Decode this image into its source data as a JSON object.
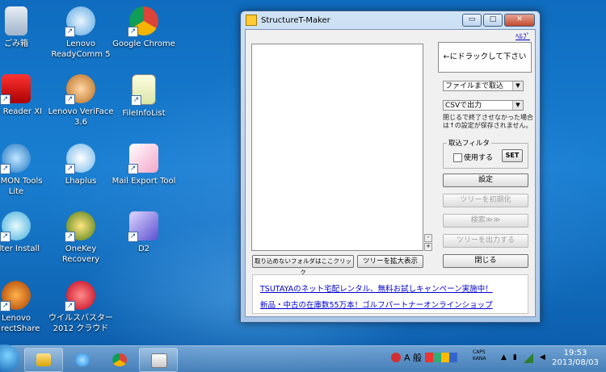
{
  "desktop": {
    "icons": [
      {
        "label": "ごみ箱",
        "icon": "recycle-bin-icon"
      },
      {
        "label": "Lenovo ReadyComm 5",
        "icon": "readycomm-icon"
      },
      {
        "label": "Google Chrome",
        "icon": "chrome-icon"
      },
      {
        "label": "be Reader XI",
        "icon": "adobe-reader-icon"
      },
      {
        "label": "Lenovo VeriFace 3.6",
        "icon": "veriface-icon"
      },
      {
        "label": "FileInfoList",
        "icon": "fileinfolist-icon"
      },
      {
        "label": "AEMON Tools Lite",
        "icon": "daemon-tools-icon"
      },
      {
        "label": "Lhaplus",
        "icon": "lhaplus-icon"
      },
      {
        "label": "Mail Export Tool",
        "icon": "mail-export-icon"
      },
      {
        "label": "Filter Install",
        "icon": "filter-install-icon"
      },
      {
        "label": "OneKey Recovery",
        "icon": "onekey-recovery-icon"
      },
      {
        "label": "D2",
        "icon": "d2-icon"
      },
      {
        "label": "Lenovo DirectShare",
        "icon": "directshare-icon"
      },
      {
        "label": "ウイルスバスター 2012 クラウド",
        "icon": "virusbuster-icon"
      }
    ]
  },
  "window": {
    "title": "StructureT-Maker",
    "help_link": "ﾍﾙﾌﾟ",
    "title_buttons": {
      "minimize": "▭",
      "maximize": "□",
      "close": "✕"
    },
    "drop_zone": "←にドラックして下さい",
    "select_read": "ファイルまで取込",
    "select_output": "CSVで出力",
    "note": "閉じるで終了させなかった場合は↑の設定が保存されません。",
    "filter": {
      "legend": "取込フィルタ",
      "checkbox_label": "使用する",
      "checked": false,
      "set_button": "SET"
    },
    "buttons": {
      "settings": "設定",
      "init_tree": "ツリーを初期化",
      "search": "検索≫≫",
      "output_tree": "ツリーを出力する",
      "close": "閉じる"
    },
    "scroll": {
      "minus": "-",
      "plus": "+"
    },
    "bottom_buttons": {
      "unloaded_folder": "取り込めないフォルダはここクリック",
      "expand_tree": "ツリーを拡大表示"
    },
    "ads": [
      "TSUTAYAのネット宅配レンタル、無料お試しキャンペーン実施中！",
      "新品・中古の在庫数55万本！ゴルフパートナーオンラインショップ"
    ]
  },
  "taskbar": {
    "ime": "A 般",
    "caps": "CAPS",
    "kana": "KANA",
    "time": "19:53",
    "date": "2013/08/03"
  },
  "colors": {
    "link": "#0000cc",
    "desktop": "#1a7fd1",
    "close_button": "#c24a2d"
  }
}
